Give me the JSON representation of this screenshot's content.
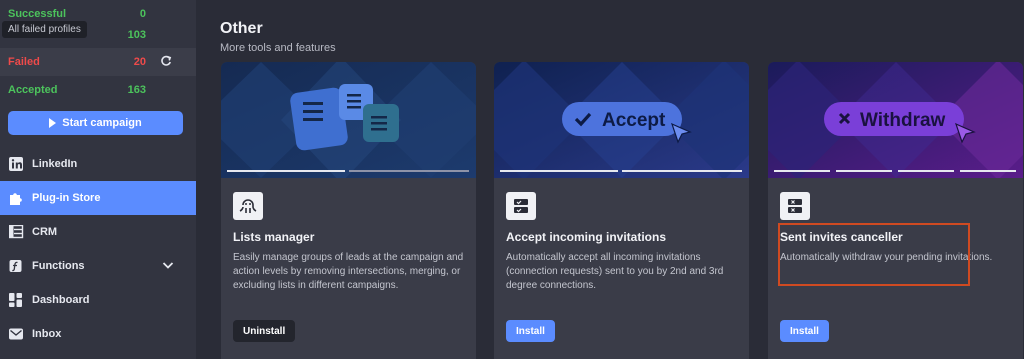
{
  "sidebar": {
    "stats": [
      {
        "label": "Successful",
        "value": "0"
      },
      {
        "label": "All",
        "value": "103"
      },
      {
        "label": "Failed",
        "value": "20"
      },
      {
        "label": "Accepted",
        "value": "163"
      }
    ],
    "tooltip": "All failed profiles",
    "start_button": "Start campaign",
    "nav": [
      {
        "label": "LinkedIn",
        "icon": "linkedin-icon"
      },
      {
        "label": "Plug-in Store",
        "icon": "puzzle-icon"
      },
      {
        "label": "CRM",
        "icon": "table-icon"
      },
      {
        "label": "Functions",
        "icon": "function-icon"
      },
      {
        "label": "Dashboard",
        "icon": "dashboard-icon"
      },
      {
        "label": "Inbox",
        "icon": "mail-icon"
      }
    ]
  },
  "main": {
    "title": "Other",
    "subtitle": "More tools and features",
    "cards": [
      {
        "title": "Lists manager",
        "description": "Easily manage groups of leads at the campaign and action levels by removing intersections, merging, or excluding lists in different campaigns.",
        "button": "Uninstall",
        "icon": "octopus-icon"
      },
      {
        "title": "Accept incoming invitations",
        "description": "Automatically accept all incoming invitations (connection requests) sent to you by 2nd and 3rd degree connections.",
        "button": "Install",
        "banner_label": "Accept",
        "icon": "checklist-icon"
      },
      {
        "title": "Sent invites canceller",
        "description": "Automatically withdraw your pending invitations.",
        "button": "Install",
        "banner_label": "Withdraw",
        "icon": "crosslist-icon"
      }
    ]
  },
  "colors": {
    "accent": "#5b8cff",
    "success": "#4cc35c",
    "danger": "#ef4a4a",
    "highlight": "#cf4a21"
  }
}
